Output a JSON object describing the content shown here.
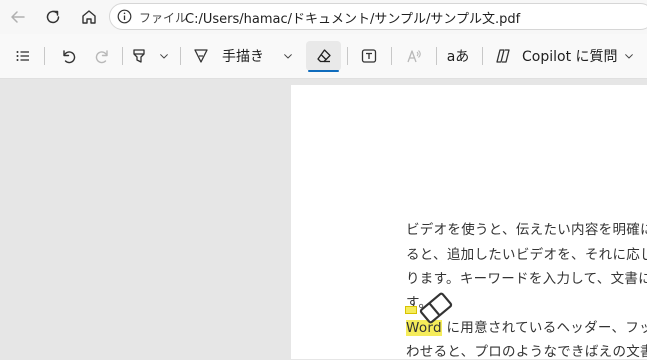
{
  "address_bar": {
    "protocol_label": "ファイル",
    "path": "C:/Users/hamac/ドキュメント/サンプル/サンプル文.pdf"
  },
  "toolbar": {
    "draw_label": "手描き",
    "copilot_label": "Copilot に質問",
    "text_direction_label": "aあ",
    "active_tool": "eraser-icon",
    "accent_color": "#0f6cbd"
  },
  "document": {
    "lines": [
      "ビデオを使うと、伝えたい内容を明確に",
      "ると、追加したいビデオを、それに応じ",
      "ります。キーワードを入力して、文書に",
      "す。",
      "Word に用意されているヘッダー、フッ",
      "わせると、プロのようなできばえの文書"
    ],
    "highlighted_word": "Word",
    "highlight_color": "#f5ec5a"
  }
}
